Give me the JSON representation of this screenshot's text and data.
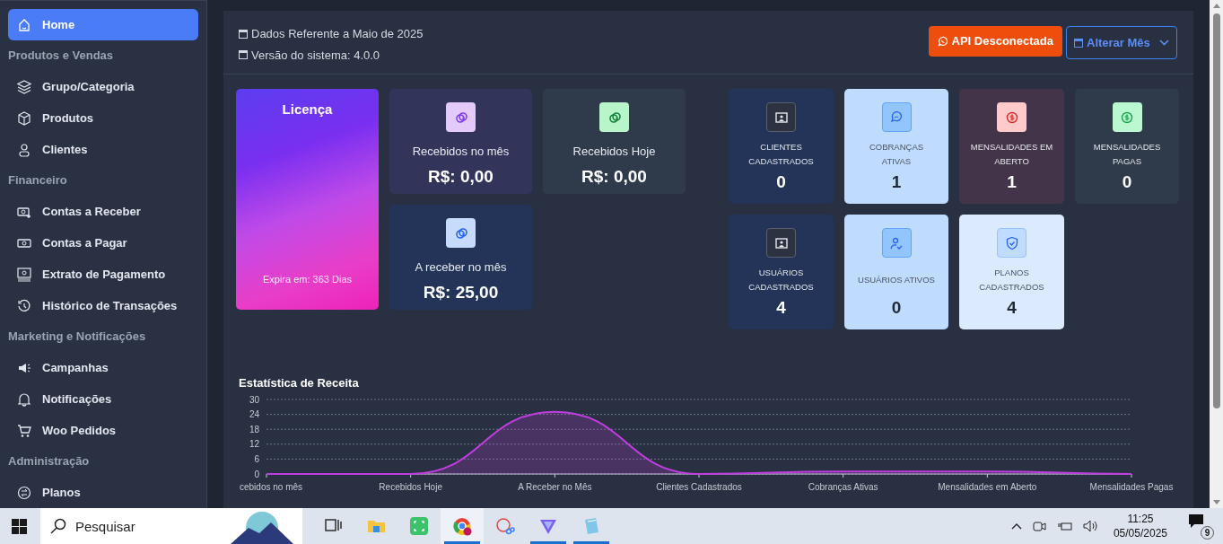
{
  "sidebar": {
    "items": [
      {
        "kind": "link",
        "label": "Home",
        "selected": true
      },
      {
        "kind": "section",
        "label": "Produtos e Vendas"
      },
      {
        "kind": "link",
        "label": "Grupo/Categoria",
        "selected": false
      },
      {
        "kind": "link",
        "label": "Produtos",
        "selected": false
      },
      {
        "kind": "link",
        "label": "Clientes",
        "selected": false
      },
      {
        "kind": "section",
        "label": "Financeiro"
      },
      {
        "kind": "link",
        "label": "Contas a Receber",
        "selected": false
      },
      {
        "kind": "link",
        "label": "Contas a Pagar",
        "selected": false
      },
      {
        "kind": "link",
        "label": "Extrato de Pagamento",
        "selected": false
      },
      {
        "kind": "link",
        "label": "Histórico de Transações",
        "selected": false
      },
      {
        "kind": "section",
        "label": "Marketing e Notificações"
      },
      {
        "kind": "link",
        "label": "Campanhas",
        "selected": false
      },
      {
        "kind": "link",
        "label": "Notificações",
        "selected": false
      },
      {
        "kind": "link",
        "label": "Woo Pedidos",
        "selected": false
      },
      {
        "kind": "section",
        "label": "Administração"
      },
      {
        "kind": "link",
        "label": "Planos",
        "selected": false
      }
    ]
  },
  "header": {
    "info": [
      "Dados Referente a Maio de 2025",
      "Versão do sistema: 4.0.0"
    ],
    "api_button": "API Desconectada",
    "month_button": "Alterar Mês"
  },
  "license": {
    "title": "Licença",
    "expiry": "Expira em: 363 Dias"
  },
  "money_cards": [
    {
      "kind": "purple",
      "label": "Recebidos no mês",
      "value": "R$: 0,00"
    },
    {
      "kind": "green",
      "label": "Recebidos Hoje",
      "value": "R$: 0,00"
    },
    {
      "kind": "blue",
      "label": "A receber no mês",
      "value": "R$: 25,00"
    }
  ],
  "stat_tiles": [
    {
      "kind": "navy",
      "label": "CLIENTES CADASTRADOS",
      "value": "0"
    },
    {
      "kind": "sky",
      "label": "COBRANÇAS ATIVAS",
      "value": "1"
    },
    {
      "kind": "red",
      "label": "MENSALIDADES EM ABERTO",
      "value": "1"
    },
    {
      "kind": "green",
      "label": "MENSALIDADES PAGAS",
      "value": "0"
    },
    {
      "kind": "navy",
      "label": "USUÁRIOS CADASTRADOS",
      "value": "4"
    },
    {
      "kind": "sky",
      "label": "USUÁRIOS ATIVOS",
      "value": "0"
    },
    {
      "kind": "pale",
      "label": "PLANOS CADASTRADOS",
      "value": "4"
    }
  ],
  "revenue_chart": {
    "chart_data": {
      "type": "area",
      "title": "Estatística de Receita",
      "categories": [
        "cebidos no mês",
        "Recebidos Hoje",
        "A Receber no Mês",
        "Clientes Cadastrados",
        "Cobranças Ativas",
        "Mensalidades em Aberto",
        "Mensalidades Pagas"
      ],
      "series": [
        {
          "color": "#c03ee0",
          "values": [
            0,
            0,
            25,
            0,
            1,
            1,
            0
          ]
        }
      ],
      "grid": true,
      "ylim": [
        0,
        30
      ],
      "yticks": [
        0,
        6,
        12,
        18,
        24,
        30
      ]
    }
  },
  "taskbar": {
    "search_placeholder": "Pesquisar",
    "apps": [
      {
        "running": false,
        "selected": false
      },
      {
        "running": false,
        "selected": false
      },
      {
        "running": false,
        "selected": false
      },
      {
        "running": true,
        "selected": true
      },
      {
        "running": false,
        "selected": false
      },
      {
        "running": true,
        "selected": false
      },
      {
        "running": true,
        "selected": false
      }
    ],
    "time": "11:25",
    "date": "05/05/2025",
    "notification_count": "9"
  }
}
